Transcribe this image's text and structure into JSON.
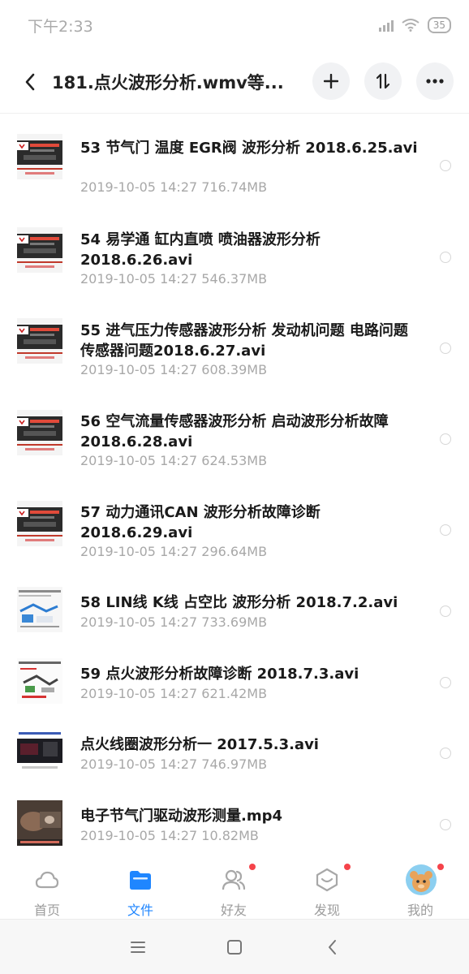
{
  "status_bar": {
    "time": "下午2:33",
    "battery": "35"
  },
  "header": {
    "back_icon": "chevron-left-icon",
    "title": "181.点火波形分析.wmv等...",
    "actions": [
      "plus-icon",
      "sort-icon",
      "more-icon"
    ]
  },
  "files": [
    {
      "name": "53  节气门  温度  EGR阀 波形分析 2018.6.25.avi",
      "date": "2019-10-05  14:27",
      "size": "716.74MB",
      "thumb": "red"
    },
    {
      "name": "54  易学通 缸内直喷 喷油器波形分析 2018.6.26.avi",
      "date": "2019-10-05  14:27",
      "size": "546.37MB",
      "thumb": "red"
    },
    {
      "name": "55 进气压力传感器波形分析 发动机问题 电路问题 传感器问题2018.6.27.avi",
      "date": "2019-10-05  14:27",
      "size": "608.39MB",
      "thumb": "red"
    },
    {
      "name": "56 空气流量传感器波形分析 启动波形分析故障2018.6.28.avi",
      "date": "2019-10-05  14:27",
      "size": "624.53MB",
      "thumb": "red"
    },
    {
      "name": "57  动力通讯CAN 波形分析故障诊断 2018.6.29.avi",
      "date": "2019-10-05  14:27",
      "size": "296.64MB",
      "thumb": "red"
    },
    {
      "name": "58  LIN线 K线  占空比 波形分析 2018.7.2.avi",
      "date": "2019-10-05  14:27",
      "size": "733.69MB",
      "thumb": "blue"
    },
    {
      "name": "59  点火波形分析故障诊断 2018.7.3.avi",
      "date": "2019-10-05  14:27",
      "size": "621.42MB",
      "thumb": "green"
    },
    {
      "name": "点火线圈波形分析一 2017.5.3.avi",
      "date": "2019-10-05  14:27",
      "size": "746.97MB",
      "thumb": "dark"
    },
    {
      "name": "电子节气门驱动波形测量.mp4",
      "date": "2019-10-05  14:27",
      "size": "10.82MB",
      "thumb": "photo"
    }
  ],
  "tabs": [
    {
      "label": "首页",
      "icon": "cloud-icon",
      "active": false,
      "badge": false
    },
    {
      "label": "文件",
      "icon": "folder-icon",
      "active": true,
      "badge": false
    },
    {
      "label": "好友",
      "icon": "friends-icon",
      "active": false,
      "badge": true
    },
    {
      "label": "发现",
      "icon": "discover-icon",
      "active": false,
      "badge": true
    },
    {
      "label": "我的",
      "icon": "avatar-icon",
      "active": false,
      "badge": true
    }
  ],
  "colors": {
    "accent": "#1f86ff",
    "badge": "#f5434a",
    "text": "#1a1a1a",
    "muted": "#a8a8a8"
  }
}
